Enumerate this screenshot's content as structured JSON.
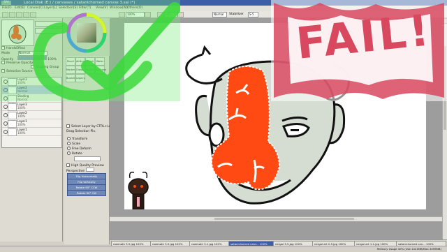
{
  "window": {
    "app_icon": "SAI",
    "title": "Local Disk (E:) / canvases / satanichorned canvas 3.sai (*)"
  },
  "menu": [
    "File(F)",
    "Edit(E)",
    "Canvas(C)",
    "Layer(L)",
    "Selection(S)",
    "Filter(T)",
    "View(V)",
    "Window(W)",
    "Others(O)"
  ],
  "toolbar": {
    "zoom": "100%",
    "angle": "+0°",
    "blend": "Normal",
    "stabilizer_label": "Stabilizer",
    "stabilizer_value": "S-5"
  },
  "left_panel": {
    "hand_effect": "HandsEffect",
    "mode_label": "Mode",
    "mode_value": "Normal",
    "opacity_label": "Opacity",
    "opacity_value": "100%",
    "preserve_opacity": "Preserve Opacity",
    "clipping_group": "Clipping Group",
    "selection_source": "Selection Source",
    "layers": [
      {
        "name": "Layer3",
        "blend": "100%",
        "selected": false
      },
      {
        "name": "Layer2",
        "blend": "Normal",
        "selected": true
      },
      {
        "name": "Shading",
        "blend": "Normal",
        "selected": false
      },
      {
        "name": "Layer3",
        "blend": "100%",
        "selected": false
      },
      {
        "name": "Layer2",
        "blend": "100%",
        "selected": false
      },
      {
        "name": "Layer1",
        "blend": "100%",
        "selected": false
      },
      {
        "name": "Layer1",
        "blend": "100%",
        "selected": false
      }
    ]
  },
  "tool_panel": {
    "tools": [
      "Pencil",
      "AirBrush",
      "Brush",
      "Water",
      "Marker",
      "Eraser",
      "SelPen",
      "SelErase",
      "Bucket",
      "Legacy"
    ],
    "select_layer_ctrl": "Select Layer by CTRL+Left",
    "drag_selection": "Drag Selection Pix.",
    "transform": "Transform",
    "scale": "Scale",
    "free_deform": "Free Deform",
    "rotate": "Rotate",
    "high_quality": "High Quality Preview",
    "perspective": "Perspective",
    "buttons": [
      "Flip Horizontally",
      "Flip Vertically",
      "Rotate 90° CCW",
      "Rotate 90° CW"
    ]
  },
  "tabs": [
    {
      "label": "rawmath 3-5.jpg",
      "zoom": "100%",
      "active": false
    },
    {
      "label": "rawmath 3-5.jpg",
      "zoom": "100%",
      "active": false
    },
    {
      "label": "rawmath 3-1.jpg",
      "zoom": "100%",
      "active": false
    },
    {
      "label": "satanichorned canv...",
      "zoom": "100%",
      "active": true
    },
    {
      "label": "nergal 3-5.jpg",
      "zoom": "100%",
      "active": false
    },
    {
      "label": "nergal art 2-5.jpg",
      "zoom": "100%",
      "active": false
    },
    {
      "label": "nergal art 1-1.jpg",
      "zoom": "100%",
      "active": false
    },
    {
      "label": "satanichorned can...",
      "zoom": "100%",
      "active": false
    }
  ],
  "status": {
    "memory": "Memory Usage 40% (Use 1441MB/Max 4096MB)"
  },
  "overlay": {
    "fail_text": "FAIL!",
    "check_color": "#3cd83c",
    "fail_color": "#d8485f"
  },
  "colors": {
    "nose": "#ff4a14",
    "face": "#d5ddd2",
    "title_bar": "#3d5fa8"
  }
}
